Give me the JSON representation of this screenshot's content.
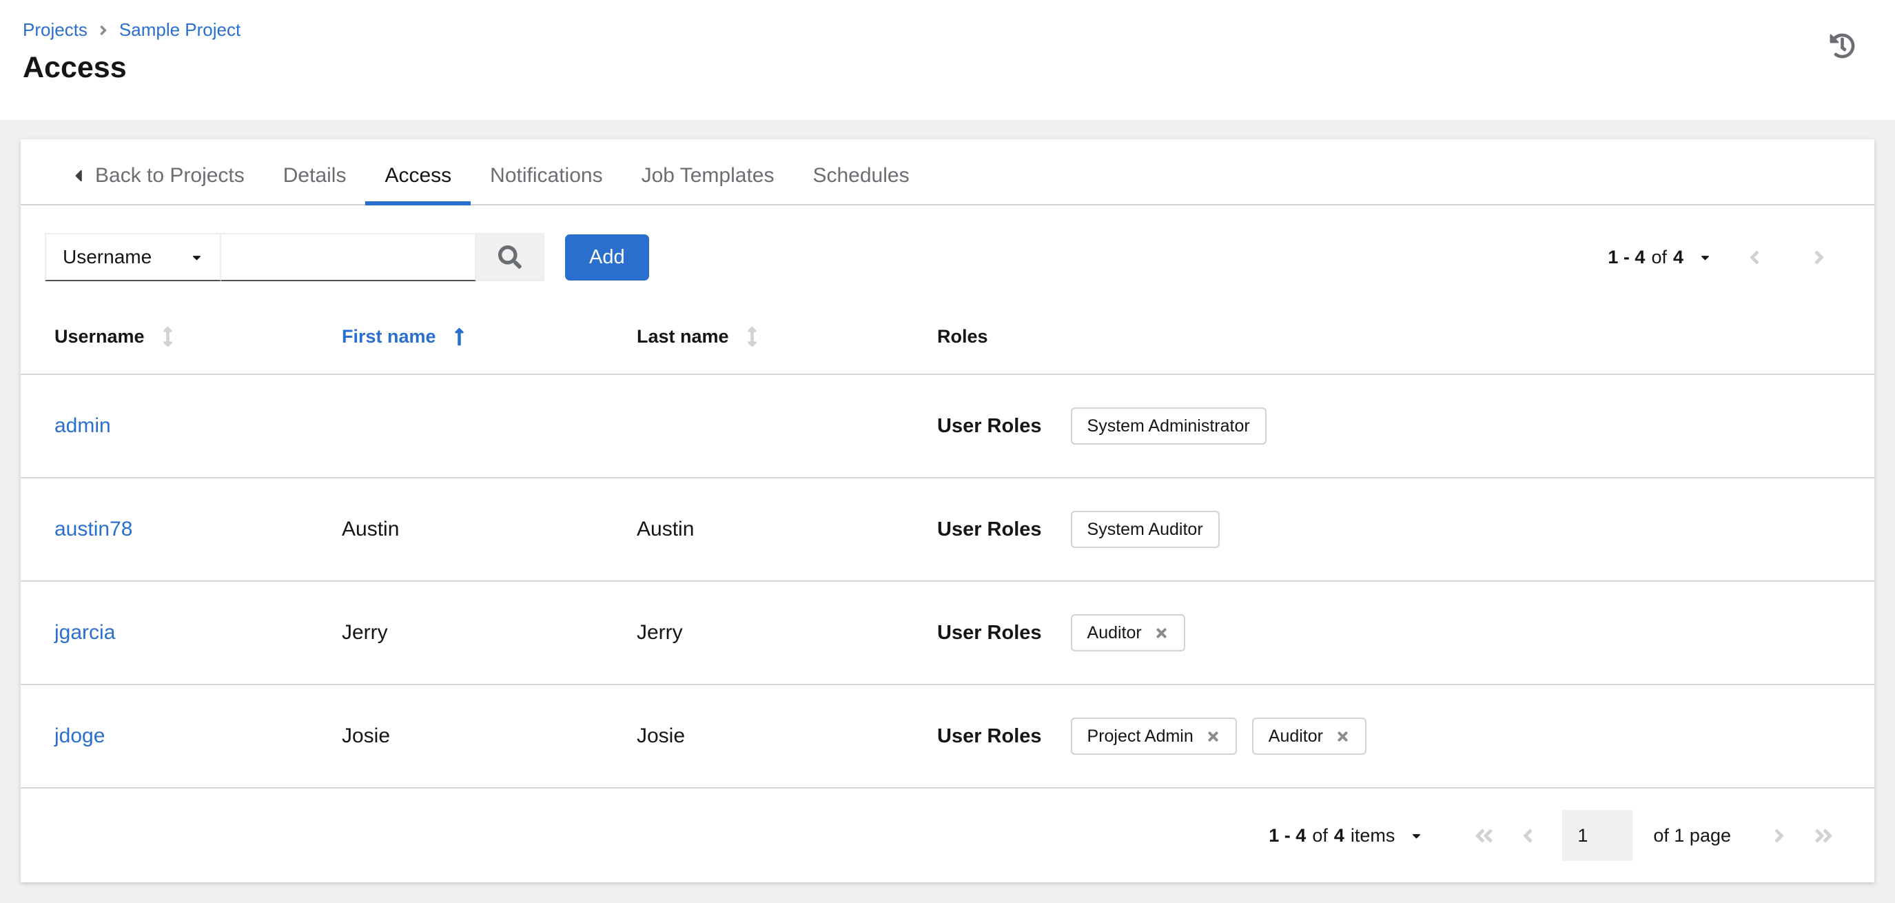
{
  "colors": {
    "accent": "#2b6fce",
    "text": "#151515",
    "muted_text": "#6a6e73",
    "disabled_arrow": "#d2d2d2",
    "panel_bg": "#ffffff",
    "page_bg": "#f0f0f0"
  },
  "icons": {
    "history-icon": "clock-with-counterclockwise-arrow",
    "search-icon": "magnifier",
    "caret-down-icon": "solid-triangle-down",
    "caret-left-icon": "solid-triangle-left",
    "sort-icon": "vertical-double-arrow",
    "sort-up-icon": "long-arrow-up",
    "close-icon": "times-x",
    "breadcrumb-separator-icon": "angle-right"
  },
  "breadcrumb": {
    "items": [
      "Projects",
      "Sample Project"
    ]
  },
  "page_title": "Access",
  "tabs": {
    "back_label": "Back to Projects",
    "items": [
      {
        "label": "Details",
        "active": false
      },
      {
        "label": "Access",
        "active": true
      },
      {
        "label": "Notifications",
        "active": false
      },
      {
        "label": "Job Templates",
        "active": false
      },
      {
        "label": "Schedules",
        "active": false
      }
    ]
  },
  "toolbar": {
    "filter_selected": "Username",
    "search_value": "",
    "search_placeholder": "",
    "add_label": "Add",
    "pagination_top": {
      "range": "1 - 4",
      "of_word": "of",
      "total": "4"
    }
  },
  "table": {
    "columns": [
      {
        "label": "Username",
        "sortable": true,
        "sorted": false
      },
      {
        "label": "First name",
        "sortable": true,
        "sorted": "ascending"
      },
      {
        "label": "Last name",
        "sortable": true,
        "sorted": false
      },
      {
        "label": "Roles",
        "sortable": false
      }
    ],
    "roles_label": "User Roles",
    "rows": [
      {
        "username": "admin",
        "first": "",
        "last": "",
        "chips": [
          {
            "label": "System Administrator",
            "dismissible": false
          }
        ]
      },
      {
        "username": "austin78",
        "first": "Austin",
        "last": "Austin",
        "chips": [
          {
            "label": "System Auditor",
            "dismissible": false
          }
        ]
      },
      {
        "username": "jgarcia",
        "first": "Jerry",
        "last": "Jerry",
        "chips": [
          {
            "label": "Auditor",
            "dismissible": true
          }
        ]
      },
      {
        "username": "jdoge",
        "first": "Josie",
        "last": "Josie",
        "chips": [
          {
            "label": "Project Admin",
            "dismissible": true
          },
          {
            "label": "Auditor",
            "dismissible": true
          }
        ]
      }
    ]
  },
  "footer": {
    "items_range": "1 - 4",
    "of_word": "of",
    "items_total": "4",
    "items_word": "items",
    "page_current": "1",
    "page_of_label": "of 1 page"
  }
}
